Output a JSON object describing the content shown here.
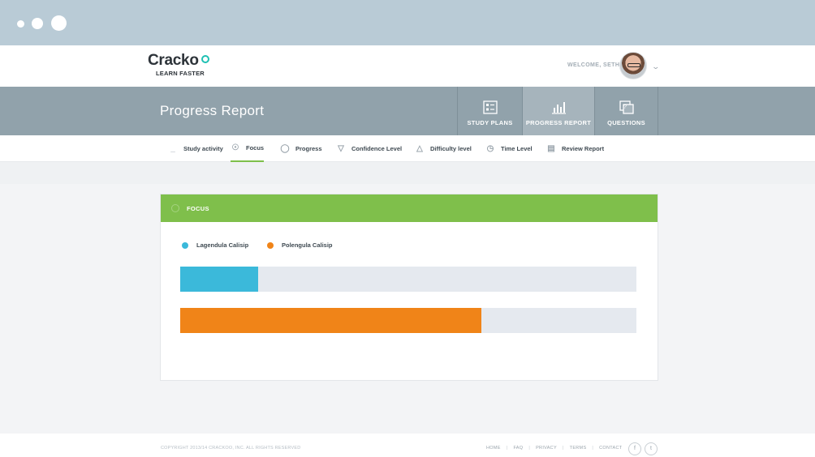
{
  "header": {
    "logo_text": "Cracko",
    "logo_tagline": "LEARN FASTER",
    "welcome": "WELCOME, SETH"
  },
  "band": {
    "page_title": "Progress Report",
    "nav": [
      {
        "label": "STUDY PLANS",
        "icon": "study-plans-icon"
      },
      {
        "label": "PROGRESS REPORT",
        "icon": "bar-chart-icon"
      },
      {
        "label": "QUESTIONS",
        "icon": "questions-icon"
      }
    ],
    "active_nav": "PROGRESS REPORT"
  },
  "tabs": [
    {
      "label": "Study activity",
      "icon": "activity-icon"
    },
    {
      "label": "Focus",
      "icon": "focus-icon"
    },
    {
      "label": "Progress",
      "icon": "progress-icon"
    },
    {
      "label": "Confidence Level",
      "icon": "shield-icon"
    },
    {
      "label": "Difficulty level",
      "icon": "weight-icon"
    },
    {
      "label": "Time Level",
      "icon": "clock-icon"
    },
    {
      "label": "Review Report",
      "icon": "report-icon"
    }
  ],
  "active_tab": "Focus",
  "card": {
    "title": "FOCUS",
    "legend": [
      {
        "label": "Lagendula Calisip",
        "color": "#3bb9da"
      },
      {
        "label": "Polengula  Calisip",
        "color": "#f08418"
      }
    ]
  },
  "chart_data": {
    "type": "bar",
    "orientation": "horizontal",
    "series": [
      {
        "name": "Lagendula Calisip",
        "value": 0.17,
        "color": "#3bb9da"
      },
      {
        "name": "Polengula  Calisip",
        "value": 0.66,
        "color": "#f08418"
      }
    ],
    "track_color": "#e5e9ef"
  },
  "footer": {
    "copyright": "COPYRIGHT 2013/14 CRACKOO, INC. ALL RIGHTS RESERVED",
    "links": [
      "HOME",
      "FAQ",
      "PRIVACY",
      "TERMS",
      "CONTACT"
    ],
    "social": [
      {
        "name": "facebook-icon",
        "glyph": "f"
      },
      {
        "name": "twitter-icon",
        "glyph": "t"
      }
    ]
  }
}
